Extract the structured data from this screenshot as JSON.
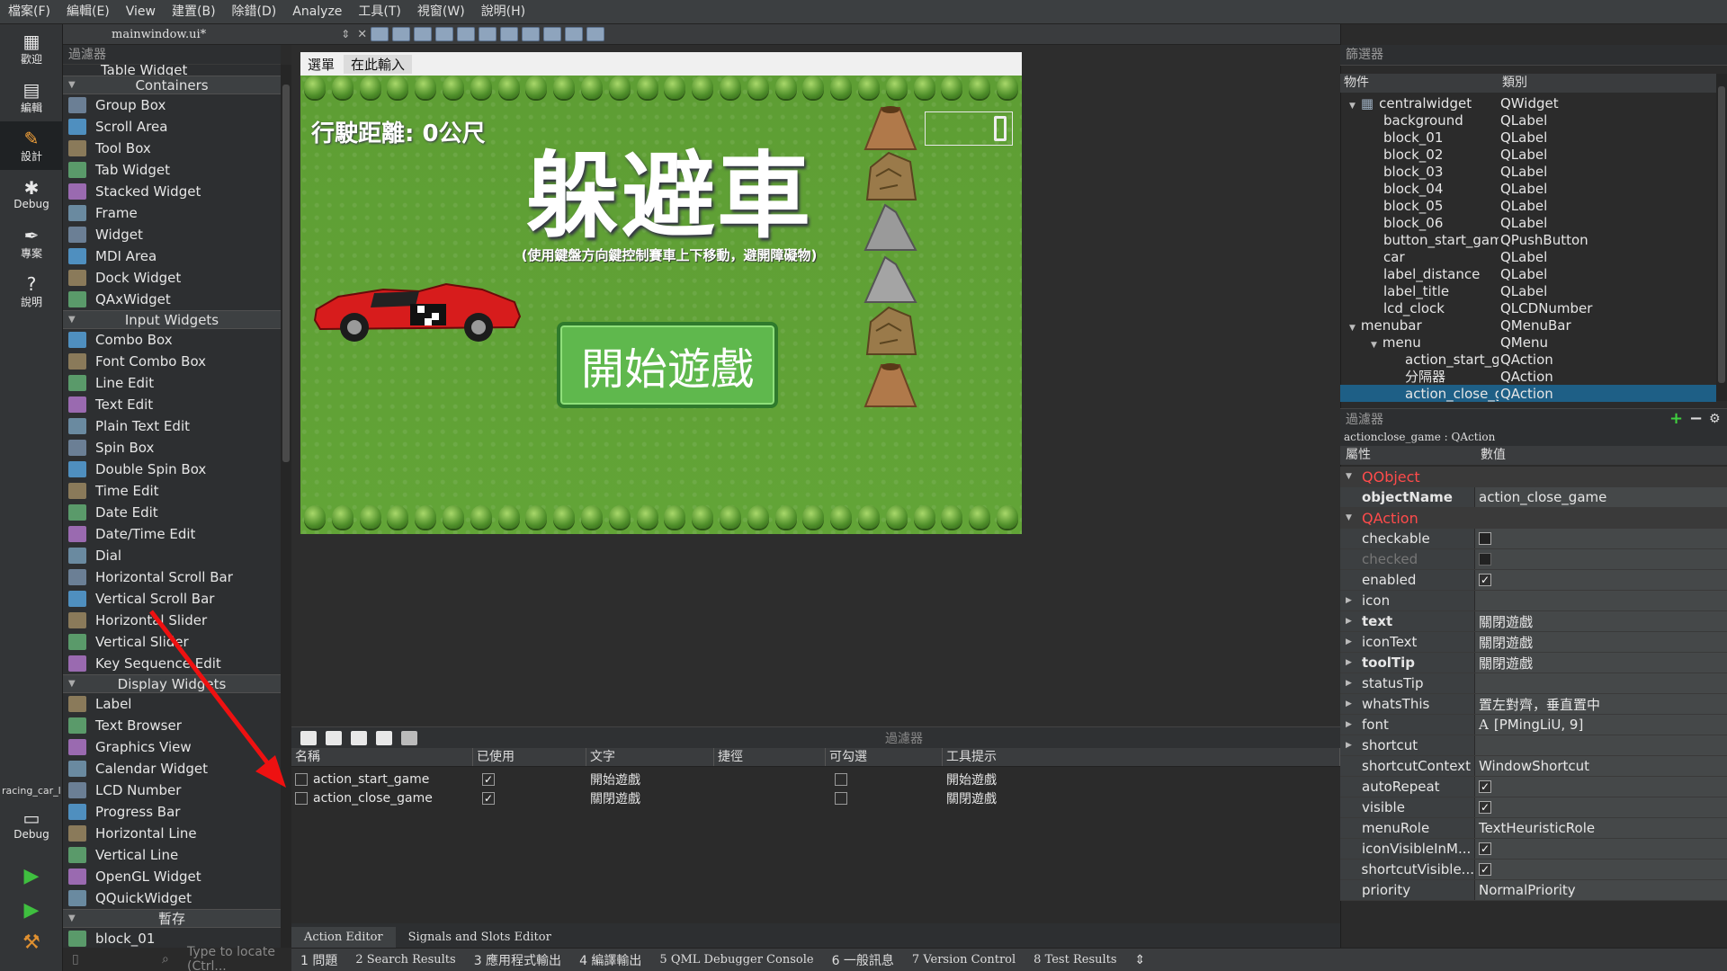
{
  "menubar": [
    "檔案(F)",
    "編輯(E)",
    "View",
    "建置(B)",
    "除錯(D)",
    "Analyze",
    "工具(T)",
    "視窗(W)",
    "說明(H)"
  ],
  "modes": [
    {
      "label": "歡迎",
      "icon": "▦"
    },
    {
      "label": "編輯",
      "icon": "▤"
    },
    {
      "label": "設計",
      "icon": "✎"
    },
    {
      "label": "Debug",
      "icon": "✱"
    },
    {
      "label": "專案",
      "icon": "✒"
    },
    {
      "label": "說明",
      "icon": "?"
    }
  ],
  "project_label": "racing_car_l",
  "debug_target_label": "Debug",
  "document": {
    "filename": "mainwindow.ui*"
  },
  "widget_box": {
    "filter_placeholder": "過濾器",
    "partial_top": "Table Widget",
    "categories": [
      {
        "name": "Containers",
        "items": [
          "Group Box",
          "Scroll Area",
          "Tool Box",
          "Tab Widget",
          "Stacked Widget",
          "Frame",
          "Widget",
          "MDI Area",
          "Dock Widget",
          "QAxWidget"
        ]
      },
      {
        "name": "Input Widgets",
        "items": [
          "Combo Box",
          "Font Combo Box",
          "Line Edit",
          "Text Edit",
          "Plain Text Edit",
          "Spin Box",
          "Double Spin Box",
          "Time Edit",
          "Date Edit",
          "Date/Time Edit",
          "Dial",
          "Horizontal Scroll Bar",
          "Vertical Scroll Bar",
          "Horizontal Slider",
          "Vertical Slider",
          "Key Sequence Edit"
        ]
      },
      {
        "name": "Display Widgets",
        "items": [
          "Label",
          "Text Browser",
          "Graphics View",
          "Calendar Widget",
          "LCD Number",
          "Progress Bar",
          "Horizontal Line",
          "Vertical Line",
          "OpenGL Widget",
          "QQuickWidget"
        ]
      },
      {
        "name": "暫存",
        "items": [
          "block_01"
        ]
      }
    ],
    "locate_placeholder": "Type to locate (Ctrl..."
  },
  "form": {
    "menu_label": "選單",
    "type_here": "在此輸入",
    "distance_label": "行駛距離: 0公尺",
    "title": "躲避車",
    "subtitle": "(使用鍵盤方向鍵控制賽車上下移動，避開障礙物)",
    "start_button": "開始遊戲"
  },
  "action_editor": {
    "filter_placeholder": "過濾器",
    "columns": [
      "名稱",
      "已使用",
      "文字",
      "捷徑",
      "可勾選",
      "工具提示"
    ],
    "rows": [
      {
        "name": "action_start_game",
        "used": true,
        "text": "開始遊戲",
        "shortcut": "",
        "checkable": false,
        "tooltip": "開始遊戲"
      },
      {
        "name": "action_close_game",
        "used": true,
        "text": "關閉遊戲",
        "shortcut": "",
        "checkable": false,
        "tooltip": "關閉遊戲"
      }
    ],
    "tabs": [
      "Action Editor",
      "Signals and Slots Editor"
    ]
  },
  "statusbar": [
    "1 問題",
    "2 Search Results",
    "3 應用程式輸出",
    "4 編譯輸出",
    "5 QML Debugger Console",
    "6 一般訊息",
    "7 Version Control",
    "8 Test Results"
  ],
  "object_inspector": {
    "filter_placeholder": "篩選器",
    "columns": [
      "物件",
      "類別"
    ],
    "rows": [
      {
        "name": "centralwidget",
        "cls": "QWidget",
        "indent": 1,
        "expander": "▼"
      },
      {
        "name": "background",
        "cls": "QLabel",
        "indent": 2,
        "expander": ""
      },
      {
        "name": "block_01",
        "cls": "QLabel",
        "indent": 2,
        "expander": ""
      },
      {
        "name": "block_02",
        "cls": "QLabel",
        "indent": 2,
        "expander": ""
      },
      {
        "name": "block_03",
        "cls": "QLabel",
        "indent": 2,
        "expander": ""
      },
      {
        "name": "block_04",
        "cls": "QLabel",
        "indent": 2,
        "expander": ""
      },
      {
        "name": "block_05",
        "cls": "QLabel",
        "indent": 2,
        "expander": ""
      },
      {
        "name": "block_06",
        "cls": "QLabel",
        "indent": 2,
        "expander": ""
      },
      {
        "name": "button_start_game",
        "cls": "QPushButton",
        "indent": 2,
        "expander": ""
      },
      {
        "name": "car",
        "cls": "QLabel",
        "indent": 2,
        "expander": ""
      },
      {
        "name": "label_distance",
        "cls": "QLabel",
        "indent": 2,
        "expander": ""
      },
      {
        "name": "label_title",
        "cls": "QLabel",
        "indent": 2,
        "expander": ""
      },
      {
        "name": "lcd_clock",
        "cls": "QLCDNumber",
        "indent": 2,
        "expander": ""
      },
      {
        "name": "menubar",
        "cls": "QMenuBar",
        "indent": 1,
        "expander": "▼"
      },
      {
        "name": "menu",
        "cls": "QMenu",
        "indent": 2,
        "expander": "▼"
      },
      {
        "name": "action_start_game",
        "cls": "QAction",
        "indent": 3,
        "expander": ""
      },
      {
        "name": "分隔器",
        "cls": "QAction",
        "indent": 3,
        "expander": ""
      },
      {
        "name": "action_close_game",
        "cls": "QAction",
        "indent": 3,
        "expander": "",
        "selected": true
      }
    ]
  },
  "property_editor": {
    "filter_placeholder": "過濾器",
    "object_line": "actionclose_game : QAction",
    "columns": [
      "屬性",
      "數值"
    ],
    "rows": [
      {
        "type": "group",
        "name": "QObject"
      },
      {
        "type": "prop",
        "name": "objectName",
        "value": "action_close_game",
        "bold": true
      },
      {
        "type": "group",
        "name": "QAction"
      },
      {
        "type": "check",
        "name": "checkable",
        "checked": false
      },
      {
        "type": "check",
        "name": "checked",
        "checked": false,
        "disabled": true
      },
      {
        "type": "check",
        "name": "enabled",
        "checked": true
      },
      {
        "type": "prop",
        "name": "icon",
        "value": "",
        "expander": true
      },
      {
        "type": "prop",
        "name": "text",
        "value": "關閉遊戲",
        "expander": true,
        "bold": true
      },
      {
        "type": "prop",
        "name": "iconText",
        "value": "關閉遊戲",
        "expander": true
      },
      {
        "type": "prop",
        "name": "toolTip",
        "value": "關閉遊戲",
        "expander": true,
        "bold": true
      },
      {
        "type": "prop",
        "name": "statusTip",
        "value": "",
        "expander": true
      },
      {
        "type": "prop",
        "name": "whatsThis",
        "value": "置左對齊，垂直置中",
        "expander": true
      },
      {
        "type": "prop",
        "name": "font",
        "value": "[PMingLiU, 9]",
        "expander": true,
        "font_icon": "A"
      },
      {
        "type": "prop",
        "name": "shortcut",
        "value": "",
        "expander": true
      },
      {
        "type": "prop",
        "name": "shortcutContext",
        "value": "WindowShortcut"
      },
      {
        "type": "check",
        "name": "autoRepeat",
        "checked": true
      },
      {
        "type": "check",
        "name": "visible",
        "checked": true
      },
      {
        "type": "prop",
        "name": "menuRole",
        "value": "TextHeuristicRole"
      },
      {
        "type": "check",
        "name": "iconVisibleInM...",
        "checked": true
      },
      {
        "type": "check",
        "name": "shortcutVisible...",
        "checked": true
      },
      {
        "type": "prop",
        "name": "priority",
        "value": "NormalPriority"
      }
    ]
  },
  "colors": {
    "accent_red": "#ff4b4b",
    "selection": "#1e5f86",
    "grass": "#62a437",
    "start_button": "#5fb84d"
  }
}
